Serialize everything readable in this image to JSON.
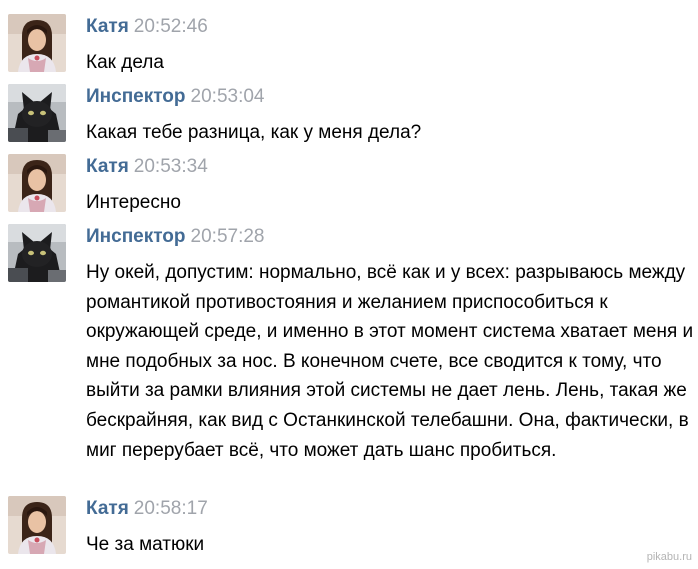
{
  "messages": [
    {
      "author": "Катя",
      "time": "20:52:46",
      "text": "Как дела",
      "avatar": "girl-avatar"
    },
    {
      "author": "Инспектор",
      "time": "20:53:04",
      "text": "Какая тебе разница, как у меня дела?",
      "avatar": "cat-avatar"
    },
    {
      "author": "Катя",
      "time": "20:53:34",
      "text": "Интересно",
      "avatar": "girl-avatar"
    },
    {
      "author": "Инспектор",
      "time": "20:57:28",
      "text": "Ну окей, допустим: нормально, всё как и у всех: разрываюсь между романтикой противостояния и желанием приспособиться к окружающей среде, и именно в этот момент система хватает меня и мне подобных за нос. В конечном счете, все сводится к тому, что выйти за рамки влияния этой системы не дает лень. Лень, такая же бескрайняя, как вид с Останкинской телебашни. Она, фактически, в миг перерубает всё, что может дать шанс пробиться.",
      "avatar": "cat-avatar"
    },
    {
      "author": "Катя",
      "time": "20:58:17",
      "text": "Че за матюки",
      "avatar": "girl-avatar"
    }
  ],
  "watermark": "pikabu.ru",
  "colors": {
    "author_name": "#436b95",
    "timestamp": "#a0a4ab",
    "message_text": "#000000",
    "background": "#ffffff"
  }
}
